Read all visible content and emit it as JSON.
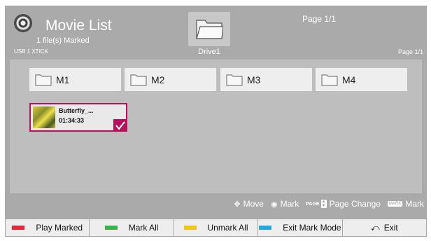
{
  "header": {
    "title": "Movie List",
    "subtitle": "1 file(s) Marked",
    "device": "USB 1 XTICK",
    "drive_label": "Drive1",
    "page_top": "Page 1/1",
    "page_right": "Page 1/1"
  },
  "folders": [
    {
      "name": "M1"
    },
    {
      "name": "M2"
    },
    {
      "name": "M3"
    },
    {
      "name": "M4"
    }
  ],
  "movie": {
    "name": "Butterfly_...",
    "duration": "01:34:33",
    "marked": true
  },
  "hints": {
    "move": "Move",
    "mark": "Mark",
    "page_key": "PAGE",
    "page_change": "Page Change",
    "mark_key": "MARK",
    "mark2": "Mark"
  },
  "buttons": [
    {
      "label": "Play Marked",
      "color": "#e8263a"
    },
    {
      "label": "Mark All",
      "color": "#3cb24a"
    },
    {
      "label": "Unmark All",
      "color": "#f2c51c"
    },
    {
      "label": "Exit Mark Mode",
      "color": "#25a8e0"
    },
    {
      "label": "Exit",
      "icon": "back-icon"
    }
  ],
  "colors": {
    "background": "#aaaaaa",
    "content": "#bebebe",
    "mark_accent": "#b5115c"
  }
}
